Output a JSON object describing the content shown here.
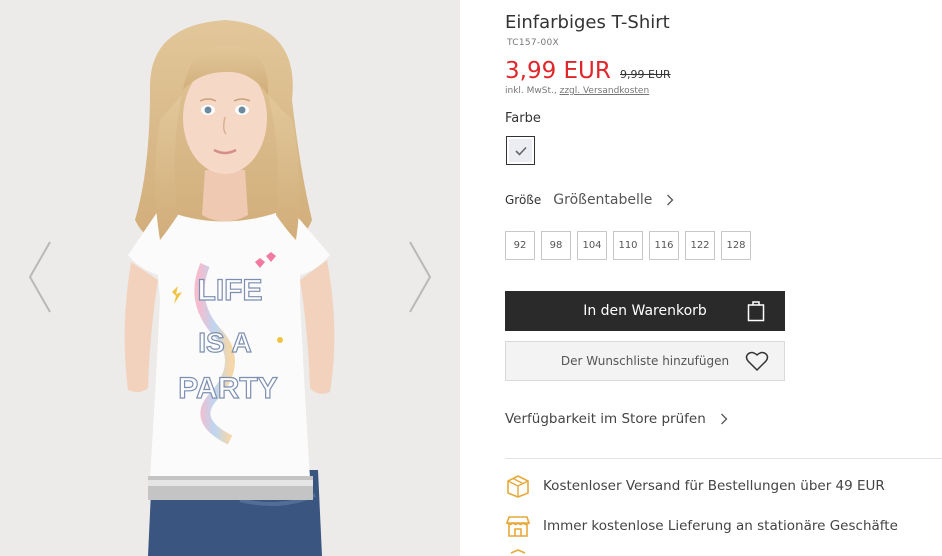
{
  "product": {
    "title": "Einfarbiges T-Shirt",
    "sku": "TC157-00X",
    "price": "3,99 EUR",
    "old_price": "9,99 EUR",
    "tax_note": "inkl. MwSt., ",
    "shipping_link": "zzgl. Versandkosten"
  },
  "color": {
    "label": "Farbe",
    "selected_swatch_color": "#ecedf3"
  },
  "size": {
    "label": "Größe",
    "table_link": "Größentabelle",
    "options": [
      "92",
      "98",
      "104",
      "110",
      "116",
      "122",
      "128"
    ]
  },
  "actions": {
    "add_to_cart": "In den Warenkorb",
    "wishlist": "Der Wunschliste hinzufügen",
    "store_check": "Verfügbarkeit im Store prüfen"
  },
  "benefits": [
    {
      "icon": "delivery-box-icon",
      "text": "Kostenloser Versand für Bestellungen über 49 EUR"
    },
    {
      "icon": "storefront-icon",
      "text": "Immer kostenlose Lieferung an stationäre Geschäfte"
    },
    {
      "icon": "return-icon",
      "text": ""
    }
  ],
  "gallery": {
    "tshirt_print": [
      "LIFE",
      "IS A",
      "PARTY"
    ]
  },
  "colors": {
    "price_red": "#e0262b",
    "button_dark": "#2a2a2a",
    "icon_gold": "#e6a93a"
  }
}
